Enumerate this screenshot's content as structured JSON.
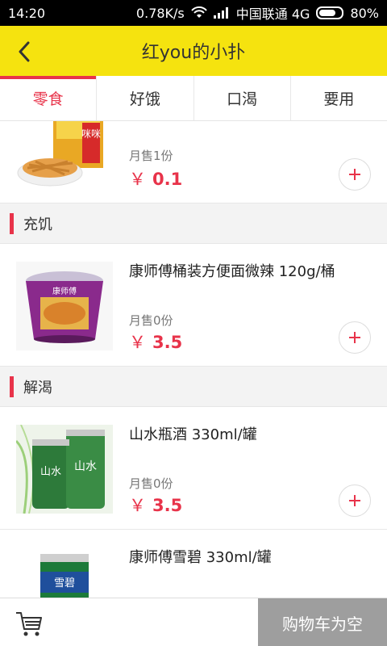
{
  "status_bar": {
    "time": "14:20",
    "speed": "0.78K/s",
    "carrier": "中国联通 4G",
    "battery": "80%"
  },
  "header": {
    "title": "红you的小扑",
    "back_icon": "chevron-left-icon",
    "background": "#f5e30f"
  },
  "tabs": [
    {
      "label": "零食",
      "active": true
    },
    {
      "label": "好饿",
      "active": false
    },
    {
      "label": "口渴",
      "active": false
    },
    {
      "label": "要用",
      "active": false
    }
  ],
  "sections": [
    {
      "label": "充饥"
    },
    {
      "label": "解渴"
    }
  ],
  "products": [
    {
      "name": "",
      "sold": "月售1份",
      "currency": "￥",
      "price": "0.1"
    },
    {
      "name": "康师傅桶装方便面微辣 120g/桶",
      "sold": "月售0份",
      "currency": "￥",
      "price": "3.5"
    },
    {
      "name": "山水瓶酒 330ml/罐",
      "sold": "月售0份",
      "currency": "￥",
      "price": "3.5"
    },
    {
      "name": "康师傅雪碧 330ml/罐",
      "sold": "",
      "currency": "",
      "price": ""
    }
  ],
  "bottom_bar": {
    "cart_icon": "cart-icon",
    "checkout_label": "购物车为空"
  },
  "colors": {
    "accent": "#e8334a",
    "header": "#f5e30f",
    "checkout_disabled": "#9e9e9e"
  }
}
